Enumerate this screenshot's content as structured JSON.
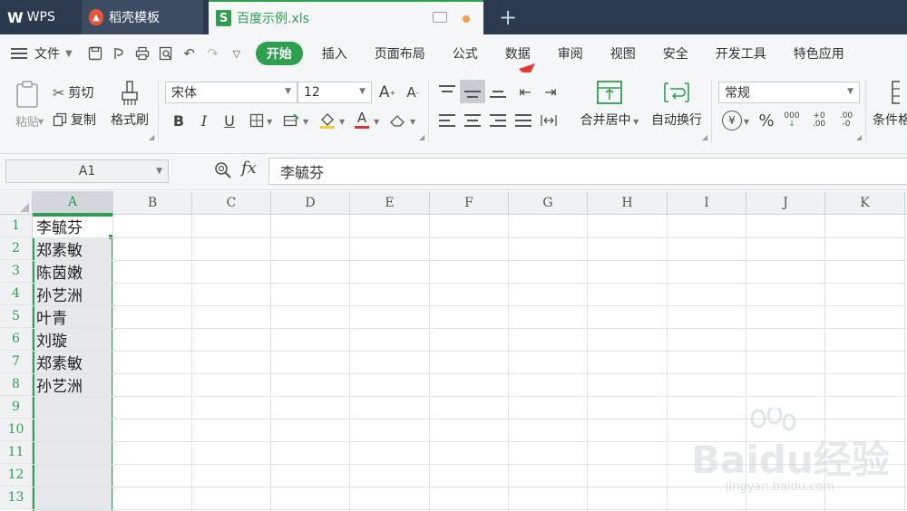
{
  "tabs": {
    "wps": "WPS",
    "template": "稻壳模板",
    "file": "百度示例.xls",
    "new_tab": "+"
  },
  "menu": {
    "file_label": "文件",
    "tabs": [
      "开始",
      "插入",
      "页面布局",
      "公式",
      "数据",
      "审阅",
      "视图",
      "安全",
      "开发工具",
      "特色应用"
    ]
  },
  "ribbon": {
    "paste": "粘贴",
    "cut": "剪切",
    "copy": "复制",
    "format_painter": "格式刷",
    "font_name": "宋体",
    "font_size": "12",
    "merge_center": "合并居中",
    "wrap_text": "自动换行",
    "number_format": "常规",
    "conditional": "条件格"
  },
  "formula_bar": {
    "name_box": "A1",
    "fx": "fx",
    "value": "李毓芬"
  },
  "sheet": {
    "columns": [
      "A",
      "B",
      "C",
      "D",
      "E",
      "F",
      "G",
      "H",
      "I",
      "J",
      "K"
    ],
    "rows": [
      "1",
      "2",
      "3",
      "4",
      "5",
      "6",
      "7",
      "8",
      "9",
      "10",
      "11",
      "12",
      "13"
    ],
    "column_a": [
      "李毓芬",
      "郑素敏",
      "陈茵嫩",
      "孙艺洲",
      "叶青",
      "刘璇",
      "郑素敏",
      "孙艺洲"
    ]
  },
  "watermark": {
    "main": "Baidu经验",
    "sub": "jingyan.baidu.com"
  },
  "colors": {
    "accent": "#2e9e4f",
    "tabbar": "#2b3a4f",
    "arrow": "#e8372f"
  }
}
